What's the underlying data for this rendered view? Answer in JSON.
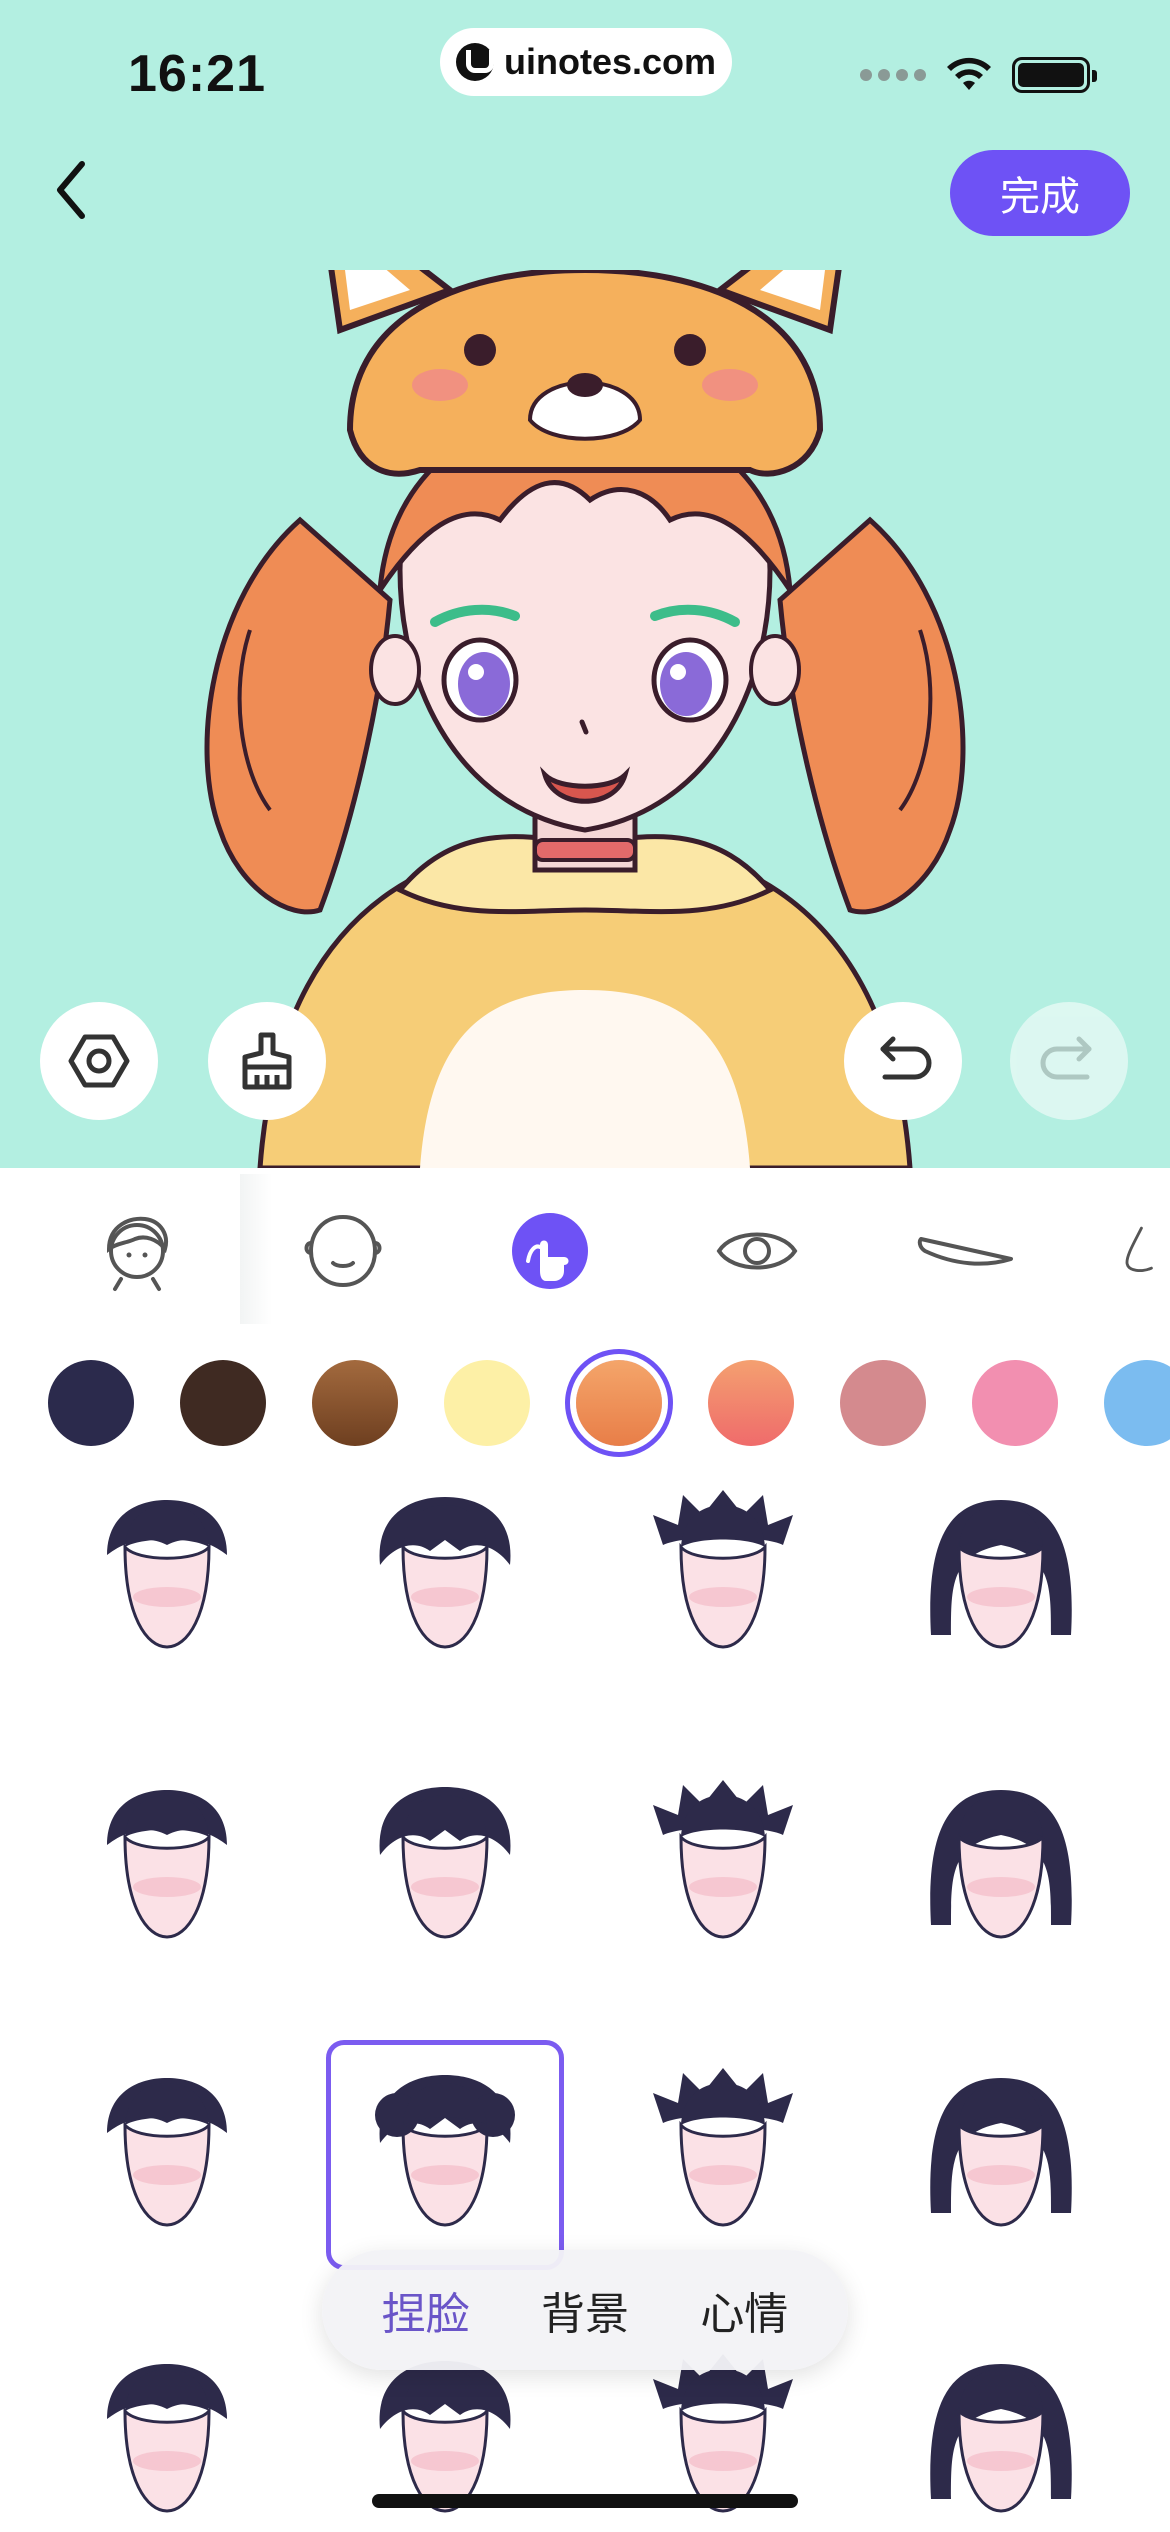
{
  "status_bar": {
    "time": "16:21",
    "url": "uinotes.com"
  },
  "header": {
    "done_label": "完成"
  },
  "categories": [
    {
      "name": "hairstyle-category",
      "icon": "hair-head-icon"
    },
    {
      "name": "face-shape-category",
      "icon": "face-outline-icon"
    },
    {
      "name": "hair-color-category",
      "icon": "hand-palette-icon"
    },
    {
      "name": "eyes-category",
      "icon": "eye-icon"
    },
    {
      "name": "eyebrow-category",
      "icon": "eyebrow-icon"
    },
    {
      "name": "nose-category",
      "icon": "nose-icon"
    }
  ],
  "hair_colors": [
    "#2b2a4c",
    "#3f2a22",
    "#8b5330",
    "#fdf0a6",
    "#f0955d",
    "#f28a6a",
    "#d48a8e",
    "#f28fb0",
    "#7bbcf0"
  ],
  "selected_hair_color_index": 4,
  "hair_styles_selected_index": 9,
  "modes": {
    "items": [
      "捏脸",
      "背景",
      "心情"
    ],
    "active_index": 0
  }
}
